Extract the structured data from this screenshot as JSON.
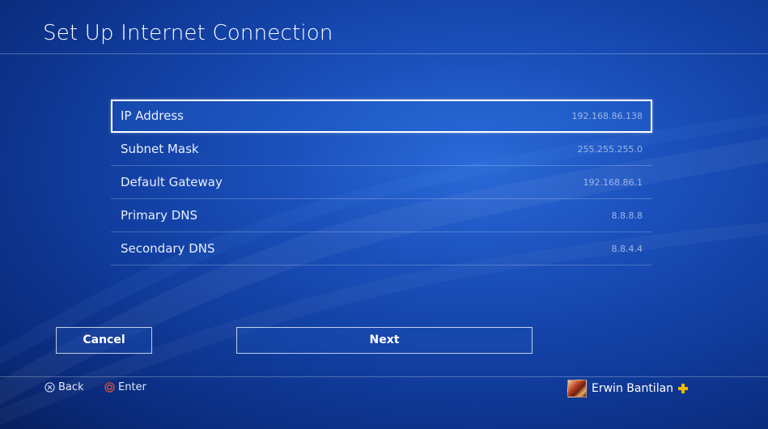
{
  "header": {
    "title": "Set Up Internet Connection"
  },
  "settings": [
    {
      "label": "IP Address",
      "value": "192.168.86.138",
      "selected": true
    },
    {
      "label": "Subnet Mask",
      "value": "255.255.255.0",
      "selected": false
    },
    {
      "label": "Default Gateway",
      "value": "192.168.86.1",
      "selected": false
    },
    {
      "label": "Primary DNS",
      "value": "8.8.8.8",
      "selected": false
    },
    {
      "label": "Secondary DNS",
      "value": "8.8.4.4",
      "selected": false
    }
  ],
  "buttons": {
    "cancel_label": "Cancel",
    "next_label": "Next"
  },
  "footer": {
    "back_label": "Back",
    "enter_label": "Enter",
    "back_icon": "cross-button-icon",
    "enter_icon": "circle-button-icon"
  },
  "user": {
    "name": "Erwin Bantilan",
    "badge_icon": "playstation-plus-icon"
  },
  "colors": {
    "background": "#1a4fba",
    "plus_badge": "#f5b800"
  }
}
